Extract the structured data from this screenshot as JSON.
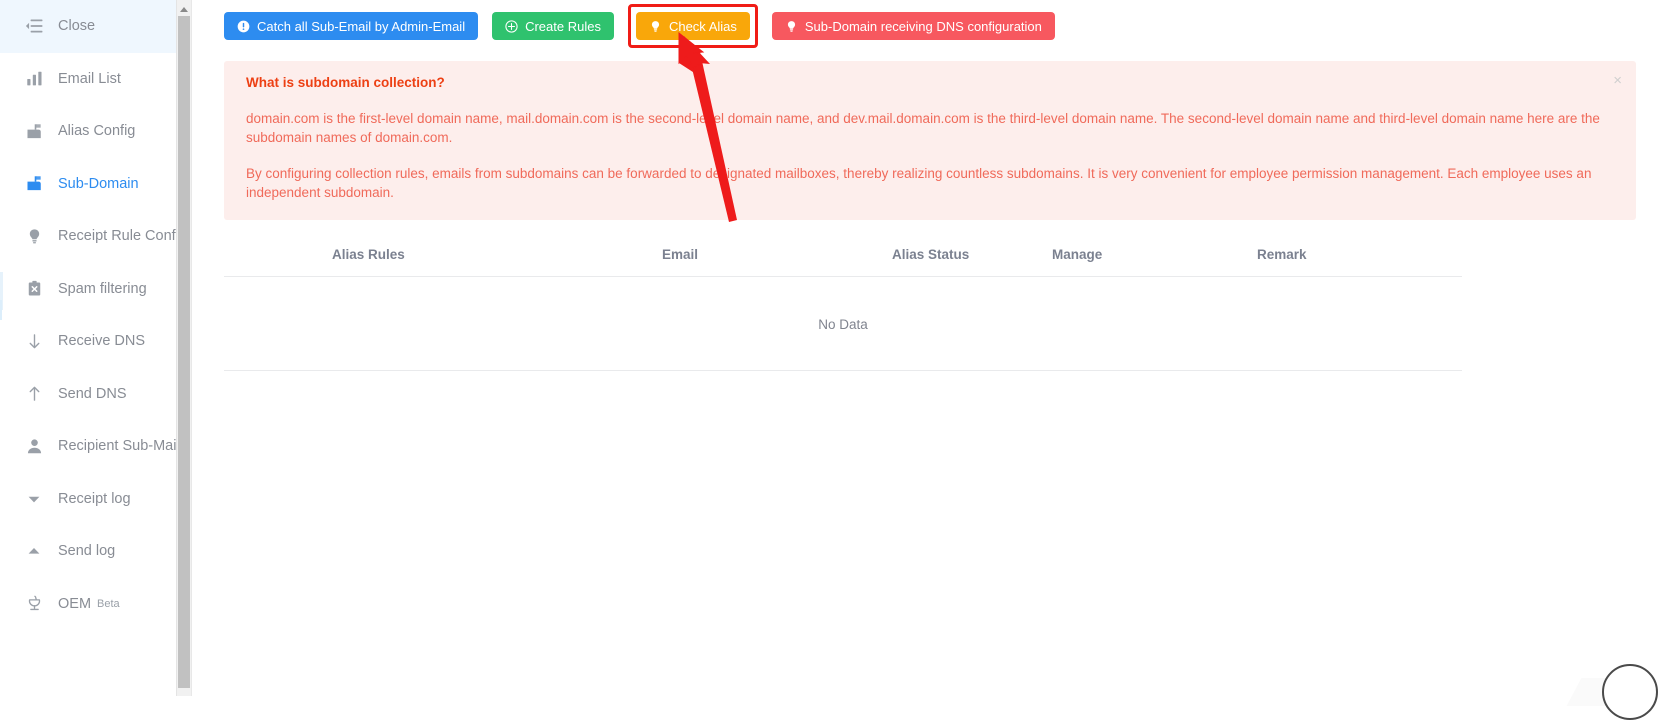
{
  "sidebar": {
    "items": [
      {
        "label": "Close",
        "icon": "menu-fold-icon",
        "name": "close",
        "active": true,
        "selected": false,
        "beta": ""
      },
      {
        "label": "Email List",
        "icon": "bar-chart-icon",
        "name": "email-list",
        "active": false,
        "selected": false,
        "beta": ""
      },
      {
        "label": "Alias Config",
        "icon": "mail-box-icon",
        "name": "alias-config",
        "active": false,
        "selected": false,
        "beta": ""
      },
      {
        "label": "Sub-Domain",
        "icon": "mail-box-icon",
        "name": "sub-domain",
        "active": false,
        "selected": true,
        "beta": ""
      },
      {
        "label": "Receipt Rule Config",
        "icon": "bulb-icon",
        "name": "receipt-rule-config",
        "active": false,
        "selected": false,
        "beta": ""
      },
      {
        "label": "Spam filtering",
        "icon": "clipboard-x-icon",
        "name": "spam-filtering",
        "active": false,
        "selected": false,
        "beta": ""
      },
      {
        "label": "Receive DNS",
        "icon": "arrow-down-icon",
        "name": "receive-dns",
        "active": false,
        "selected": false,
        "beta": ""
      },
      {
        "label": "Send DNS",
        "icon": "arrow-up-icon",
        "name": "send-dns",
        "active": false,
        "selected": false,
        "beta": ""
      },
      {
        "label": "Recipient Sub-Mail",
        "icon": "user-icon",
        "name": "recipient-sub-mail",
        "active": false,
        "selected": false,
        "beta": ""
      },
      {
        "label": "Receipt log",
        "icon": "caret-down-icon",
        "name": "receipt-log",
        "active": false,
        "selected": false,
        "beta": ""
      },
      {
        "label": "Send log",
        "icon": "caret-up-icon",
        "name": "send-log",
        "active": false,
        "selected": false,
        "beta": ""
      },
      {
        "label": "OEM",
        "icon": "trophy-icon",
        "name": "oem",
        "active": false,
        "selected": false,
        "beta": "Beta"
      }
    ]
  },
  "toolbar": {
    "catch_all_label": "Catch all Sub-Email by Admin-Email",
    "catch_all_icon": "info-circle-icon",
    "create_rules_label": "Create Rules",
    "create_rules_icon": "plus-circle-icon",
    "check_alias_label": "Check Alias",
    "check_alias_icon": "bulb-icon",
    "dns_config_label": "Sub-Domain receiving DNS configuration",
    "dns_config_icon": "bulb-icon"
  },
  "alert": {
    "title": "What is subdomain collection?",
    "paragraph1": "domain.com is the first-level domain name, mail.domain.com is the second-level domain name, and dev.mail.domain.com is the third-level domain name. The second-level domain name and third-level domain name here are the subdomain names of domain.com.",
    "paragraph2": "By configuring collection rules, emails from subdomains can be forwarded to designated mailboxes, thereby realizing countless subdomains. It is very convenient for employee permission management. Each employee uses an independent subdomain.",
    "close_label": "×"
  },
  "table": {
    "columns": [
      "Alias Rules",
      "Email",
      "Alias Status",
      "Manage",
      "Remark"
    ],
    "rows": [],
    "empty_text": "No Data"
  },
  "colors": {
    "blue": "#2d8cf0",
    "green": "#2fc26e",
    "orange": "#f9a70a",
    "red": "#f7585f",
    "highlight": "#f01c16",
    "alert_bg": "#fdeeec",
    "alert_text": "#f06a5a"
  },
  "annotation": {
    "arrow_color": "#ee1b1b",
    "pointer_icon": "cursor-arrow-icon",
    "highlight_target": "check-alias-button"
  }
}
